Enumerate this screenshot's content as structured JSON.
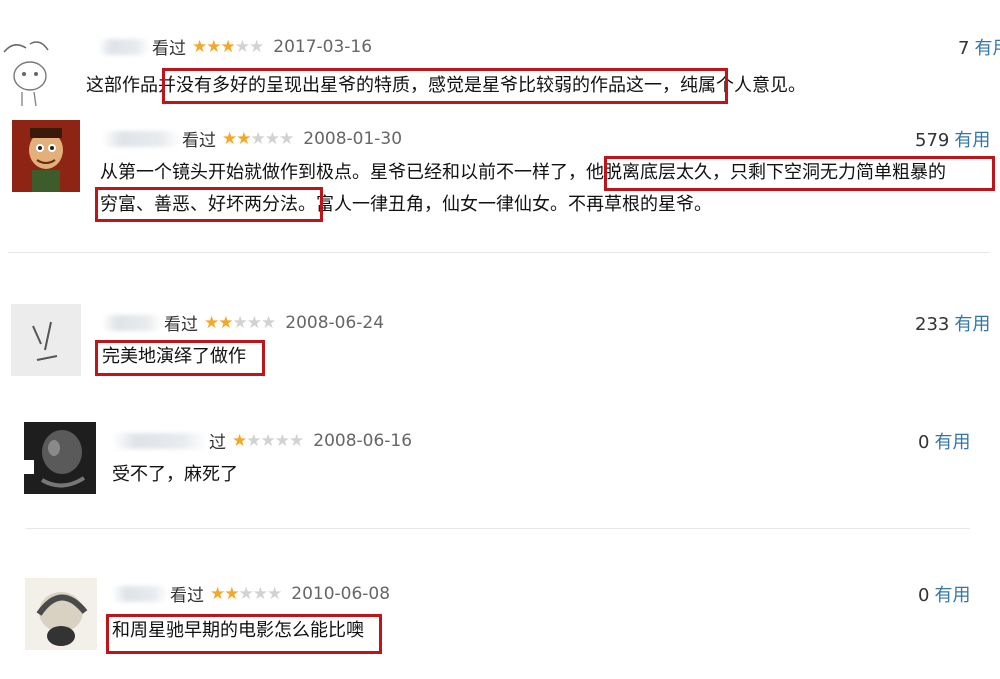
{
  "reviews": [
    {
      "status": "看过",
      "rating": 3,
      "date": "2017-03-16",
      "votes": "7",
      "useful_label": "有用",
      "content": "这部作品并没有多好的呈现出星爷的特质，感觉是星爷比较弱的作品这一，纯属个人意见。"
    },
    {
      "status": "看过",
      "rating": 2,
      "date": "2008-01-30",
      "votes": "579",
      "useful_label": "有用",
      "content_line1": "从第一个镜头开始就做作到极点。星爷已经和以前不一样了，他脱离底层太久，只剩下空洞无力简单粗暴的",
      "content_line2": "穷富、善恶、好坏两分法。富人一律丑角，仙女一律仙女。不再草根的星爷。"
    },
    {
      "status": "看过",
      "rating": 2,
      "date": "2008-06-24",
      "votes": "233",
      "useful_label": "有用",
      "content": "完美地演绎了做作"
    },
    {
      "status": "过",
      "rating": 1,
      "date": "2008-06-16",
      "votes": "0",
      "useful_label": "有用",
      "content": "受不了，麻死了"
    },
    {
      "status": "看过",
      "rating": 2,
      "date": "2010-06-08",
      "votes": "0",
      "useful_label": "有用",
      "content": "和周星驰早期的电影怎么能比噢"
    }
  ],
  "colors": {
    "star_on": "#f4a82a",
    "star_off": "#d2d2d2",
    "useful": "#3377aa",
    "highlight_box": "#c0141b"
  }
}
